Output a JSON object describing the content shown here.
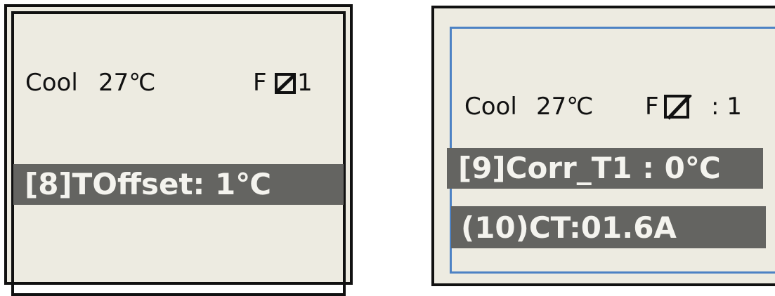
{
  "left_display": {
    "mode": "Cool",
    "temperature": "27℃",
    "fan_label": "F",
    "fan_icon": "fan-speed-box-icon",
    "fan_value": "1",
    "menu_item": "[8]TOffset: 1℃"
  },
  "right_display": {
    "mode": "Cool",
    "temperature": "27℃",
    "fan_label": "F",
    "fan_icon": "fan-speed-box-icon",
    "fan_value": ": 1",
    "menu_item_1": "[9]Corr_T1 : 0℃",
    "menu_item_2": "(10)CT:01.6A"
  },
  "colors": {
    "lcd_background": "#edebe1",
    "highlight_bar": "#646461",
    "highlight_text": "#f4f3ee",
    "frame_border": "#111111",
    "selection_border": "#4d82c4"
  }
}
